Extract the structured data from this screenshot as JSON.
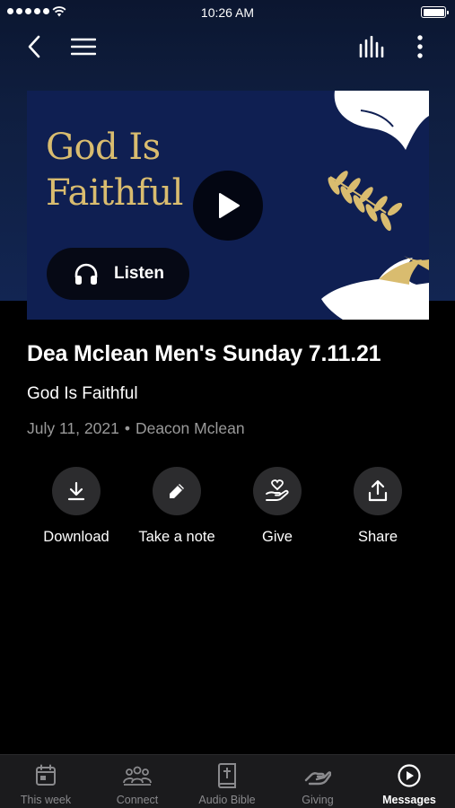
{
  "status_bar": {
    "time": "10:26 AM"
  },
  "artwork": {
    "title_line1": "God Is",
    "title_line2": "Faithful",
    "listen_label": "Listen",
    "gold": "#d9bc6f",
    "navy": "#0f1f52"
  },
  "message": {
    "title": "Dea Mclean Men's Sunday 7.11.21",
    "series": "God Is Faithful",
    "date": "July 11, 2021",
    "separator": "•",
    "speaker": "Deacon Mclean"
  },
  "actions": [
    {
      "label": "Download",
      "icon": "download-icon"
    },
    {
      "label": "Take a note",
      "icon": "pencil-icon"
    },
    {
      "label": "Give",
      "icon": "hand-heart-icon"
    },
    {
      "label": "Share",
      "icon": "share-icon"
    }
  ],
  "tabs": [
    {
      "label": "This week",
      "icon": "calendar-icon"
    },
    {
      "label": "Connect",
      "icon": "people-icon"
    },
    {
      "label": "Audio Bible",
      "icon": "bible-icon"
    },
    {
      "label": "Giving",
      "icon": "giving-hand-icon"
    },
    {
      "label": "Messages",
      "icon": "play-circle-icon",
      "active": true
    }
  ]
}
